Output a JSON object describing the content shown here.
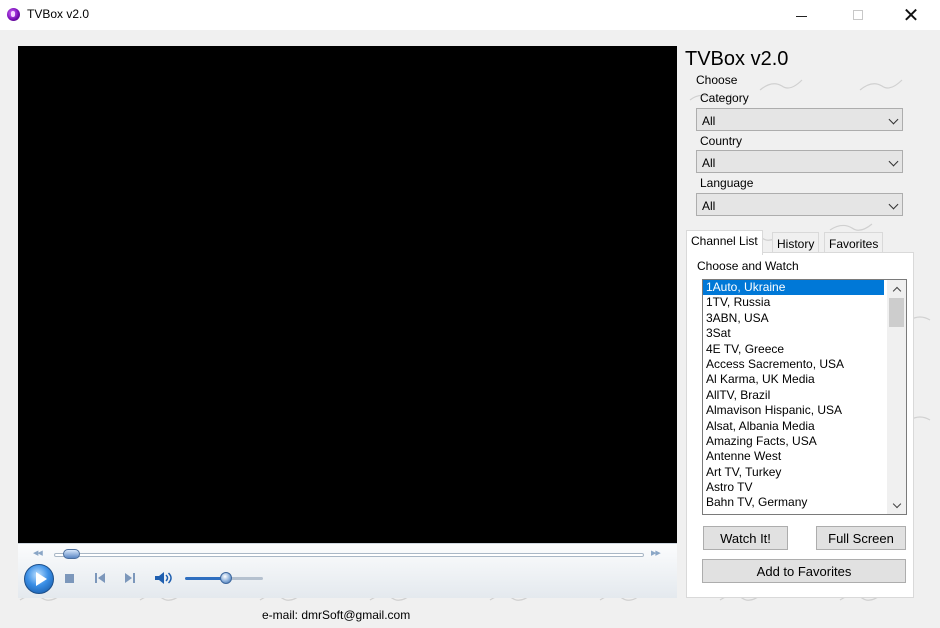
{
  "window": {
    "title": "TVBox v2.0",
    "controls": {
      "minimize": "minimize-icon",
      "maximize": "maximize-icon",
      "close": "close-icon"
    }
  },
  "player": {
    "seek_position_percent": 2,
    "volume_percent": 52,
    "icons": [
      "play-icon",
      "stop-icon",
      "previous-icon",
      "next-icon",
      "volume-icon"
    ]
  },
  "footer": {
    "email": "e-mail: dmrSoft@gmail.com"
  },
  "panel": {
    "app_title": "TVBox v2.0",
    "choose_label": "Choose",
    "category": {
      "label": "Category",
      "value": "All"
    },
    "country": {
      "label": "Country",
      "value": "All"
    },
    "language": {
      "label": "Language",
      "value": "All"
    }
  },
  "tabs": [
    {
      "label": "Channel List",
      "active": true
    },
    {
      "label": "History",
      "active": false
    },
    {
      "label": "Favorites",
      "active": false
    }
  ],
  "channel_list": {
    "label": "Choose and Watch",
    "selected_index": 0,
    "items": [
      "1Auto, Ukraine",
      "1TV, Russia",
      "3ABN, USA",
      "3Sat",
      "4E TV, Greece",
      "Access Sacremento, USA",
      "Al Karma, UK Media",
      "AllTV, Brazil",
      "Almavison Hispanic, USA",
      "Alsat, Albania Media",
      "Amazing Facts, USA",
      "Antenne West",
      "Art TV, Turkey",
      "Astro TV",
      "Bahn TV, Germany"
    ]
  },
  "buttons": {
    "watch": "Watch It!",
    "full_screen": "Full Screen",
    "add_favorites": "Add to Favorites"
  }
}
